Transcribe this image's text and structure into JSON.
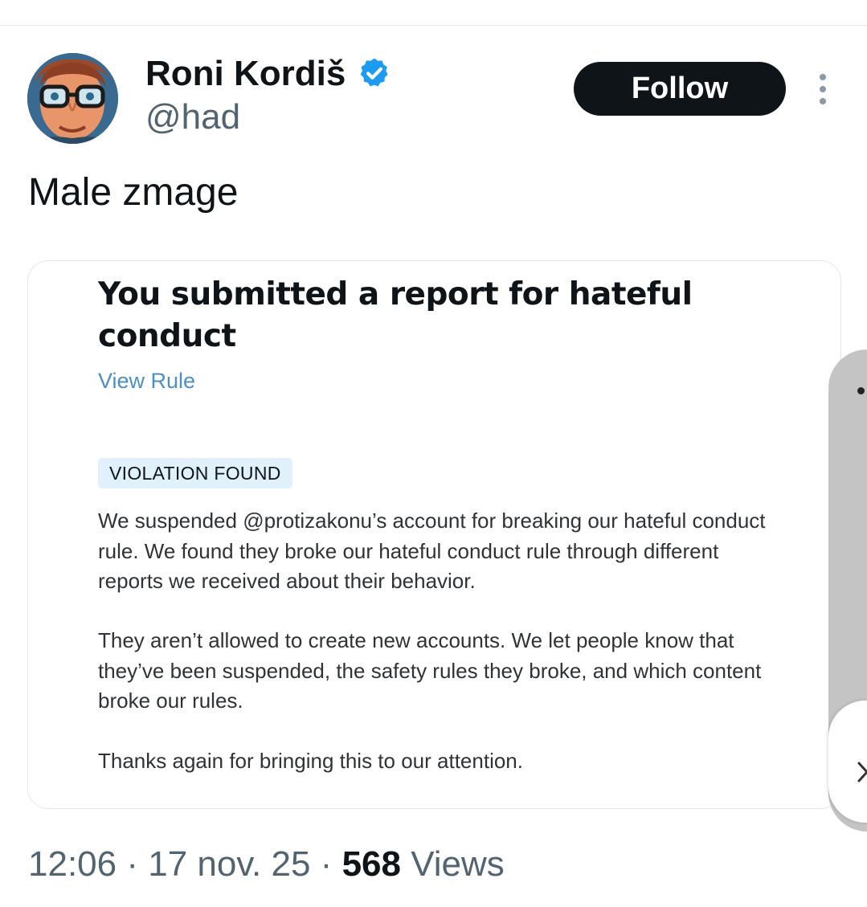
{
  "author": {
    "name": "Roni Kordiš",
    "handle": "@had",
    "verified": true
  },
  "actions": {
    "follow_label": "Follow"
  },
  "tweet": {
    "text": "Male zmage"
  },
  "report_card": {
    "title": "You submitted a report for hateful conduct",
    "view_rule_label": "View Rule",
    "badge": "VIOLATION FOUND",
    "paragraphs": [
      "We suspended @protizakonu’s account for breaking our hateful conduct rule. We found they broke our hateful conduct rule through different reports we received about their behavior.",
      "They aren’t allowed to create new accounts. We let people know that they’ve been suspended, the safety rules they broke, and which content broke our rules.",
      "Thanks again for bringing this to our attention."
    ]
  },
  "meta": {
    "time": "12:06",
    "separator": " · ",
    "date": "17 nov. 25",
    "views_count": "568",
    "views_label": " Views"
  },
  "icons": {
    "verified": "verified-badge-icon",
    "more": "more-vertical-icon",
    "chevron": "chevron-right-icon"
  },
  "colors": {
    "verified_blue": "#1d9bf0",
    "follow_bg": "#0f1419",
    "link_blue": "#4a90c4",
    "badge_bg": "#e0f1fb",
    "muted_text": "#536471"
  }
}
